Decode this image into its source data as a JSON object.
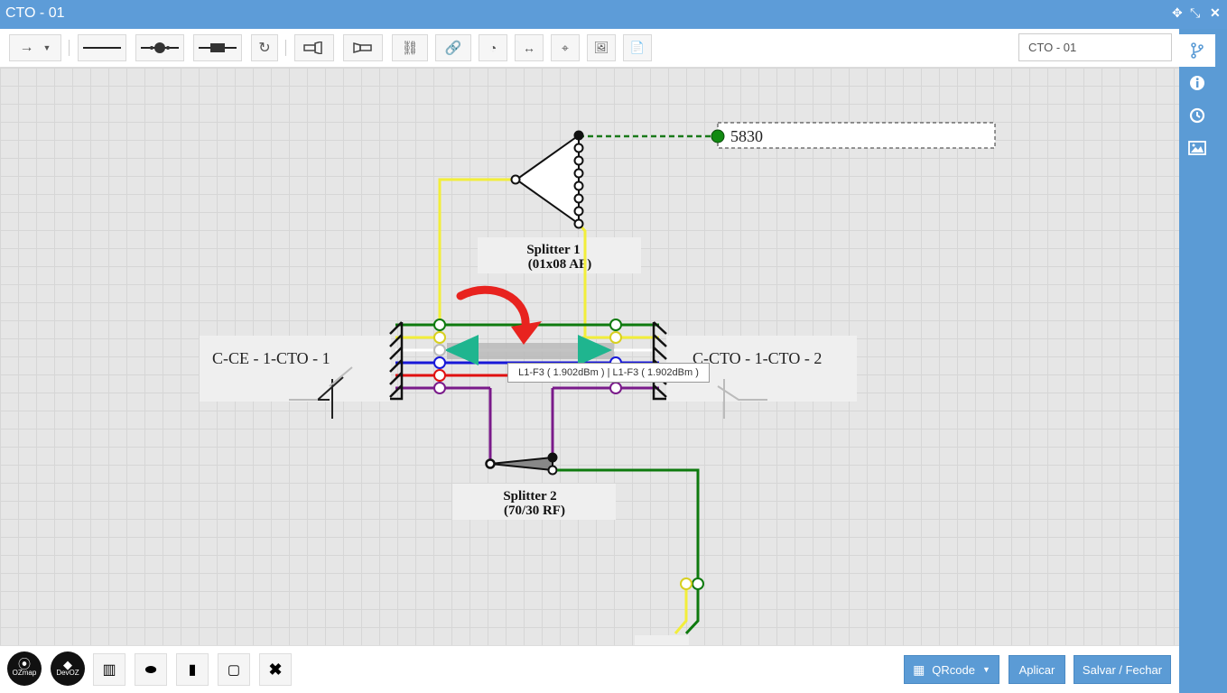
{
  "window": {
    "title": "CTO - 01"
  },
  "toolbar": {
    "name_value": "CTO - 01"
  },
  "diagram": {
    "output_label": "5830",
    "splitter1": {
      "name": "Splitter 1",
      "spec": "(01x08 AF)"
    },
    "splitter2": {
      "name": "Splitter 2",
      "spec": "(70/30 RF)"
    },
    "cable_left": "C-CE - 1-CTO - 1",
    "cable_right": "C-CTO - 1-CTO - 2",
    "tooltip": "L1-F3 ( 1.902dBm ) | L1-F3 ( 1.902dBm )",
    "splitter1_ports": [
      "1",
      "2",
      "3",
      "4",
      "5",
      "6",
      "7",
      "8"
    ]
  },
  "bottombar": {
    "logo1_text": "OZmap",
    "logo2_text": "DevOZ",
    "qrcode_label": "QRcode",
    "apply_label": "Aplicar",
    "save_close_label": "Salvar / Fechar"
  },
  "colors": {
    "accent": "#5b9bd5",
    "teal_arrow": "#1fb58f",
    "red_arrow": "#e8231f"
  }
}
